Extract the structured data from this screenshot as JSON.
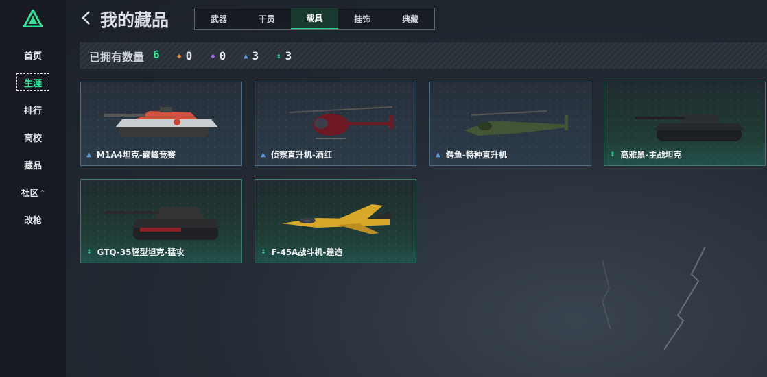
{
  "page": {
    "title": "我的藏品"
  },
  "sidebar": {
    "items": [
      {
        "label": "首页"
      },
      {
        "label": "生涯"
      },
      {
        "label": "排行"
      },
      {
        "label": "高校"
      },
      {
        "label": "藏品"
      },
      {
        "label": "社区"
      },
      {
        "label": "改枪"
      }
    ],
    "active_index": 1
  },
  "tabs": [
    {
      "label": "武器"
    },
    {
      "label": "干员"
    },
    {
      "label": "载具"
    },
    {
      "label": "挂饰"
    },
    {
      "label": "典藏"
    }
  ],
  "active_tab": 2,
  "stats": {
    "owned_label": "已拥有数量",
    "owned_count": "6",
    "orange": "0",
    "purple": "0",
    "blue": "3",
    "green": "3"
  },
  "items": [
    {
      "name": "M1A4坦克-巅峰竞赛",
      "rarity": "blue",
      "icon": "tank-icon"
    },
    {
      "name": "侦察直升机-酒红",
      "rarity": "blue",
      "icon": "helicopter-icon"
    },
    {
      "name": "鳄鱼-特种直升机",
      "rarity": "blue",
      "icon": "attack-helicopter-icon"
    },
    {
      "name": "高雅黑-主战坦克",
      "rarity": "green",
      "icon": "tank-icon"
    },
    {
      "name": "GTQ-35轻型坦克-猛攻",
      "rarity": "green",
      "icon": "light-tank-icon"
    },
    {
      "name": "F-45A战斗机-建造",
      "rarity": "green",
      "icon": "fighter-jet-icon"
    }
  ],
  "colors": {
    "accent": "#2fe59a",
    "blue_rarity": "#5e9ee0",
    "green_rarity": "#2fd59a"
  }
}
